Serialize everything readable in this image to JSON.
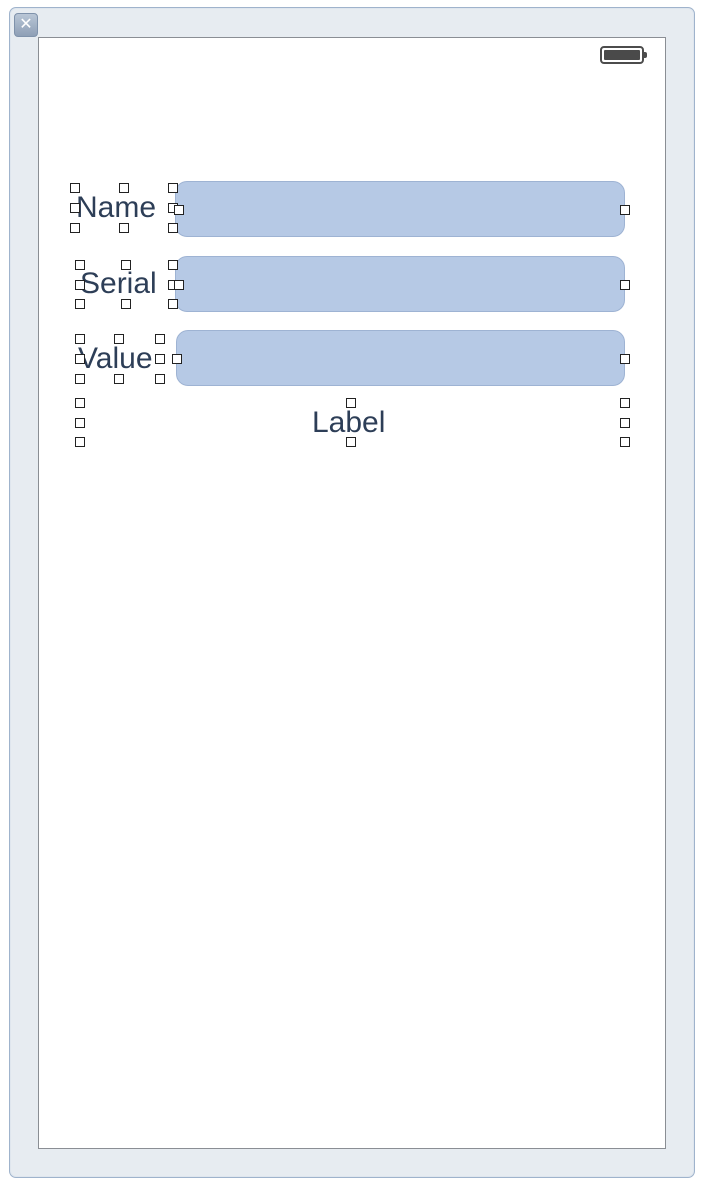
{
  "window": {
    "close_glyph": "✕",
    "close_icon": "close-icon"
  },
  "status_bar": {
    "battery_icon": "battery-full-icon"
  },
  "form": {
    "name_label": "Name",
    "serial_label": "Serial",
    "value_label": "Value",
    "name_field_value": "",
    "serial_field_value": "",
    "value_field_value": "",
    "output_label": "Label"
  },
  "colors": {
    "field_fill": "#b6c9e5",
    "label_text": "#2d3e57",
    "window_frame": "#e7ecf1"
  }
}
